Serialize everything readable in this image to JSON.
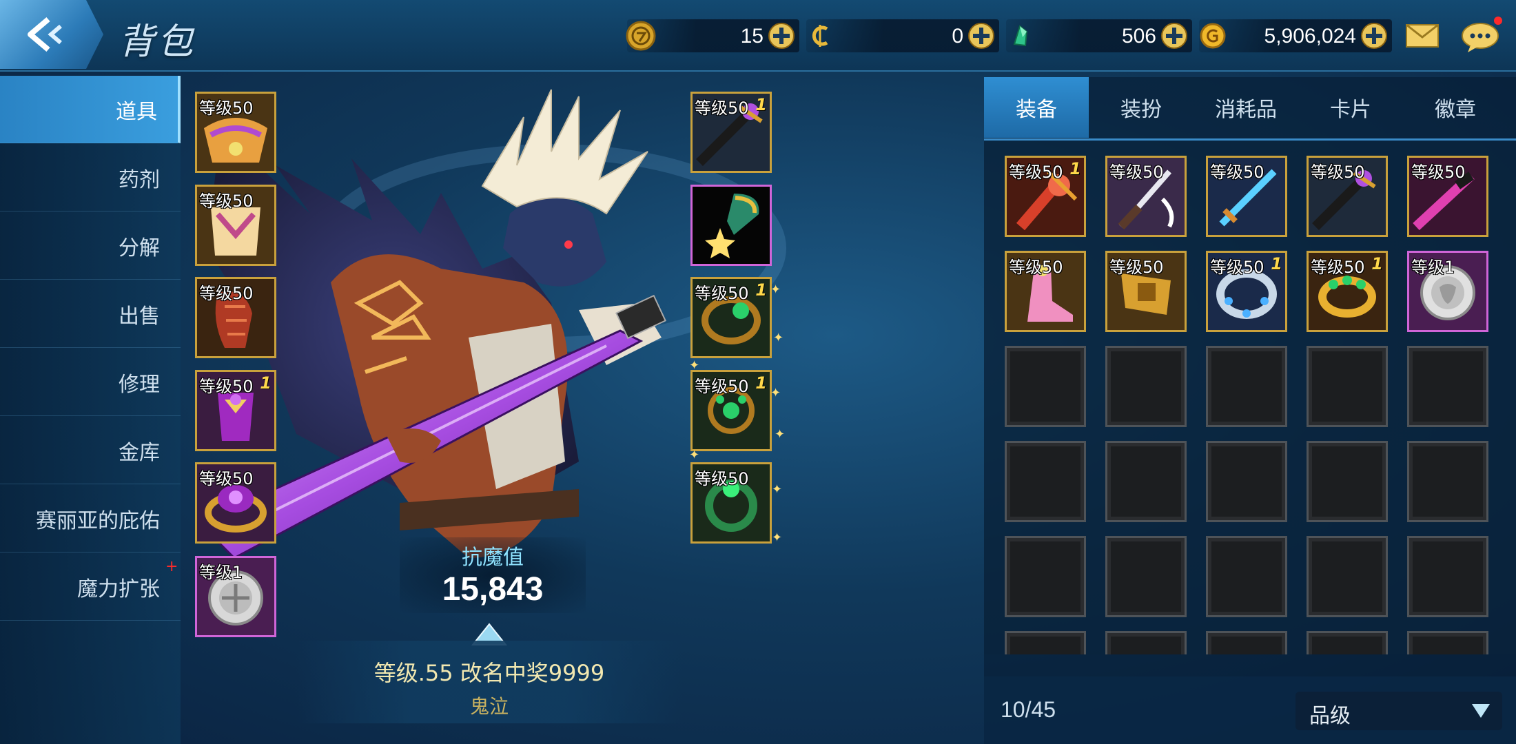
{
  "header": {
    "title": "背包",
    "currencies": [
      {
        "icon": "gold-token-icon",
        "value": "15"
      },
      {
        "icon": "cera-c-icon",
        "value": "0"
      },
      {
        "icon": "green-gem-icon",
        "value": "506"
      },
      {
        "icon": "gold-coin-icon",
        "value": "5,906,024"
      }
    ]
  },
  "left_menu": {
    "items": [
      {
        "label": "道具",
        "active": true
      },
      {
        "label": "药剂"
      },
      {
        "label": "分解"
      },
      {
        "label": "出售"
      },
      {
        "label": "修理"
      },
      {
        "label": "金库"
      },
      {
        "label": "赛丽亚的庇佑"
      },
      {
        "label": "魔力扩张",
        "badge": "+"
      }
    ]
  },
  "equipped_left": [
    {
      "level": "等级50",
      "item": "orange-shoulder-armor"
    },
    {
      "level": "等级50",
      "item": "orange-chest-armor"
    },
    {
      "level": "等级50",
      "item": "red-gauntlet"
    },
    {
      "level": "等级50",
      "enhance": "1",
      "item": "purple-belt"
    },
    {
      "level": "等级50",
      "item": "purple-ring-bracelet"
    },
    {
      "level": "等级1",
      "item": "silver-emblem"
    }
  ],
  "equipped_right": [
    {
      "level": "等级50",
      "enhance": "1",
      "item": "dark-sword"
    },
    {
      "level": "",
      "item": "title-medal"
    },
    {
      "level": "等级50",
      "enhance": "1",
      "item": "green-bracelet"
    },
    {
      "level": "等级50",
      "enhance": "1",
      "item": "green-necklace"
    },
    {
      "level": "等级50",
      "item": "green-ring"
    }
  ],
  "character": {
    "stat_label": "抗魔值",
    "stat_value": "15,843",
    "name_line": "等级.55 改名中奖9999",
    "class_name": "鬼泣"
  },
  "tabs": [
    "装备",
    "装扮",
    "消耗品",
    "卡片",
    "徽章"
  ],
  "inventory": {
    "items": [
      {
        "level": "等级50",
        "enhance": "1",
        "item": "red-blade"
      },
      {
        "level": "等级50",
        "item": "silver-katana"
      },
      {
        "level": "等级50",
        "item": "blue-sword"
      },
      {
        "level": "等级50",
        "item": "dark-sword"
      },
      {
        "level": "等级50",
        "item": "pink-blade"
      },
      {
        "level": "等级50",
        "item": "pink-boots"
      },
      {
        "level": "等级50",
        "item": "gold-belt"
      },
      {
        "level": "等级50",
        "enhance": "1",
        "item": "blue-bracelet"
      },
      {
        "level": "等级50",
        "enhance": "1",
        "item": "green-gold-ring"
      },
      {
        "level": "等级1",
        "item": "silver-emblem"
      }
    ],
    "count": "10/45",
    "sort_label": "品级"
  },
  "colors": {
    "gold_frame": "#c9a13c",
    "purple_frame": "#d065d8",
    "accent_blue": "#2f8ed2",
    "stat_label": "#8fe3ff"
  }
}
